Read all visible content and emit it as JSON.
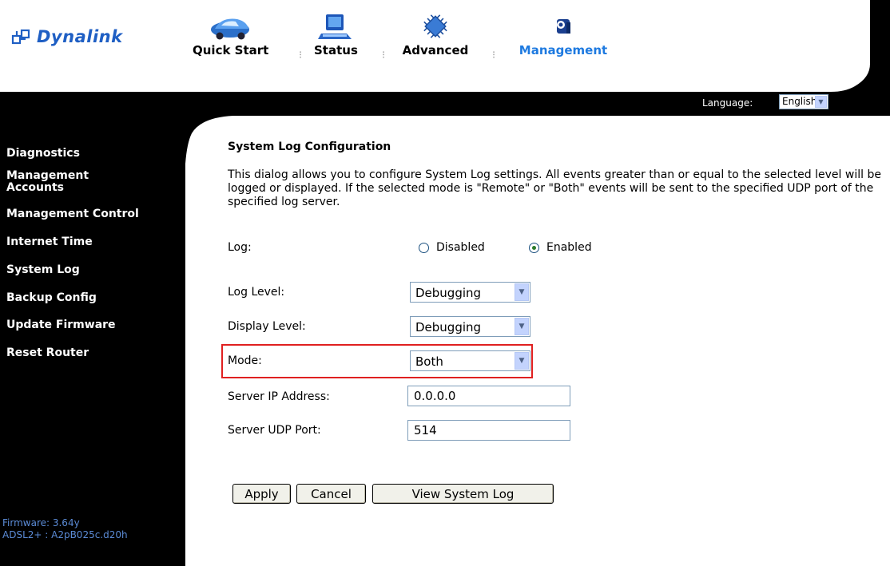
{
  "brand": {
    "name": "Dynalink",
    "color": "#1f5fc4"
  },
  "topnav": {
    "items": [
      {
        "label": "Quick Start",
        "icon": "car-icon"
      },
      {
        "label": "Status",
        "icon": "computer-icon"
      },
      {
        "label": "Advanced",
        "icon": "chip-icon"
      },
      {
        "label": "Management",
        "icon": "gear-icon",
        "active": true
      }
    ],
    "separator": "⁝",
    "active_color": "#1e7ae0"
  },
  "language": {
    "label": "Language:",
    "selected": "English"
  },
  "sidebar": {
    "items": [
      {
        "label": "Diagnostics"
      },
      {
        "label": "Management\nAccounts"
      },
      {
        "label": "Management Control"
      },
      {
        "label": "Internet Time"
      },
      {
        "label": "System Log"
      },
      {
        "label": "Backup Config"
      },
      {
        "label": "Update Firmware"
      },
      {
        "label": "Reset Router"
      }
    ],
    "firmware": "Firmware: 3.64y",
    "adsl": "ADSL2+ : A2pB025c.d20h"
  },
  "page": {
    "title": "System Log Configuration",
    "description": "This dialog allows you to configure System Log settings. All events greater than or equal to the selected level will be logged or displayed. If the selected mode is \"Remote\" or \"Both\" events will be sent to the specified UDP port of the specified log server."
  },
  "form": {
    "log_label": "Log:",
    "log_options": {
      "disabled": "Disabled",
      "enabled": "Enabled",
      "selected": "Enabled"
    },
    "log_level_label": "Log Level:",
    "log_level_value": "Debugging",
    "display_level_label": "Display Level:",
    "display_level_value": "Debugging",
    "mode_label": "Mode:",
    "mode_value": "Both",
    "server_ip_label": "Server IP Address:",
    "server_ip_value": "0.0.0.0",
    "server_port_label": "Server UDP Port:",
    "server_port_value": "514"
  },
  "buttons": {
    "apply": "Apply",
    "cancel": "Cancel",
    "view_log": "View System Log"
  },
  "highlight_color": "#e02020"
}
